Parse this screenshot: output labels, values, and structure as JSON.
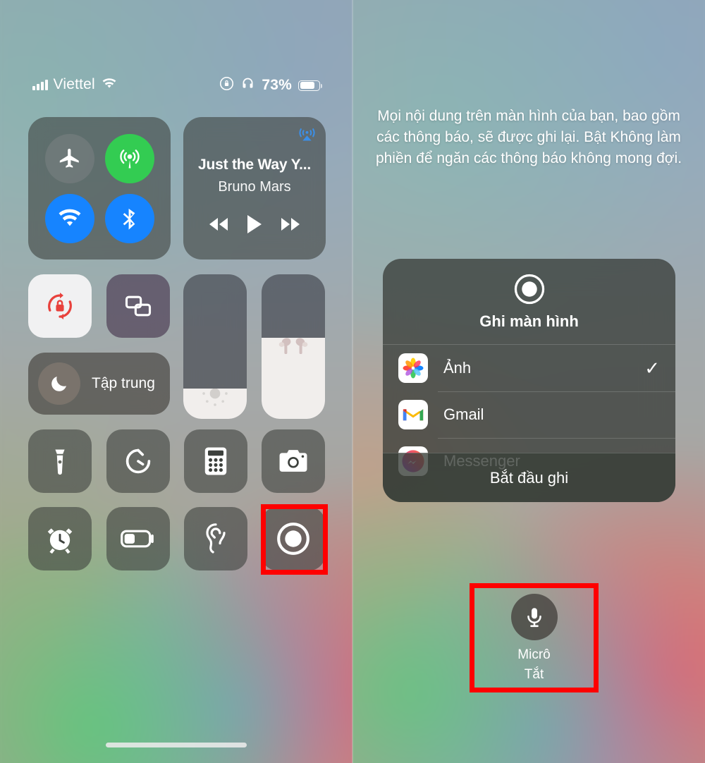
{
  "statusbar": {
    "carrier": "Viettel",
    "signal_icon": "cellular-bars-icon",
    "wifi_icon": "wifi-icon",
    "rotation_lock_icon": "rotation-lock-indicator-icon",
    "headphones_icon": "headphones-icon",
    "battery_percent": "73%",
    "battery_icon": "battery-icon"
  },
  "control_center": {
    "connectivity": {
      "airplane": {
        "label": "airplane-mode",
        "state": "off"
      },
      "cellular": {
        "label": "cellular-data",
        "state": "on"
      },
      "wifi": {
        "label": "wifi",
        "state": "on"
      },
      "bluetooth": {
        "label": "bluetooth",
        "state": "on"
      }
    },
    "media": {
      "title": "Just the Way Y...",
      "artist": "Bruno Mars",
      "airplay_icon": "airplay-audio-icon",
      "prev_icon": "rewind-icon",
      "play_icon": "play-icon",
      "next_icon": "fast-forward-icon"
    },
    "rotation_lock": {
      "icon": "rotation-lock-icon",
      "state": "on"
    },
    "screen_mirroring": {
      "icon": "screen-mirroring-icon",
      "state": "off"
    },
    "focus": {
      "label": "Tập trung",
      "icon": "moon-icon"
    },
    "brightness": {
      "icon": "brightness-icon",
      "value": 20
    },
    "volume": {
      "icon": "airpods-icon",
      "value": 55
    },
    "shortcuts": [
      {
        "name": "flashlight",
        "icon": "flashlight-icon"
      },
      {
        "name": "timer",
        "icon": "timer-icon"
      },
      {
        "name": "calculator",
        "icon": "calculator-icon"
      },
      {
        "name": "camera",
        "icon": "camera-icon"
      },
      {
        "name": "alarm",
        "icon": "alarm-clock-icon"
      },
      {
        "name": "low-power-mode",
        "icon": "battery-low-power-icon"
      },
      {
        "name": "hearing",
        "icon": "ear-hearing-icon"
      },
      {
        "name": "screen-recording",
        "icon": "screen-record-icon"
      }
    ]
  },
  "right_panel": {
    "description": "Mọi nội dung trên màn hình của bạn, bao gồm các thông báo, sẽ được ghi lại. Bật Không làm phiền để ngăn các thông báo không mong đợi.",
    "dialog": {
      "icon": "screen-record-icon",
      "title": "Ghi màn hình",
      "rows": [
        {
          "app": "Ảnh",
          "icon": "photos-app-icon",
          "selected": true,
          "check": "✓"
        },
        {
          "app": "Gmail",
          "icon": "gmail-app-icon",
          "selected": false,
          "check": ""
        },
        {
          "app": "Messenger",
          "icon": "messenger-app-icon",
          "selected": false,
          "check": ""
        }
      ],
      "start_button": "Bắt đầu ghi"
    },
    "microphone": {
      "icon": "microphone-icon",
      "label": "Micrô",
      "state": "Tắt"
    }
  },
  "highlights": {
    "color": "#ff0000",
    "targets": [
      "screen-recording-tile",
      "microphone-toggle"
    ]
  }
}
